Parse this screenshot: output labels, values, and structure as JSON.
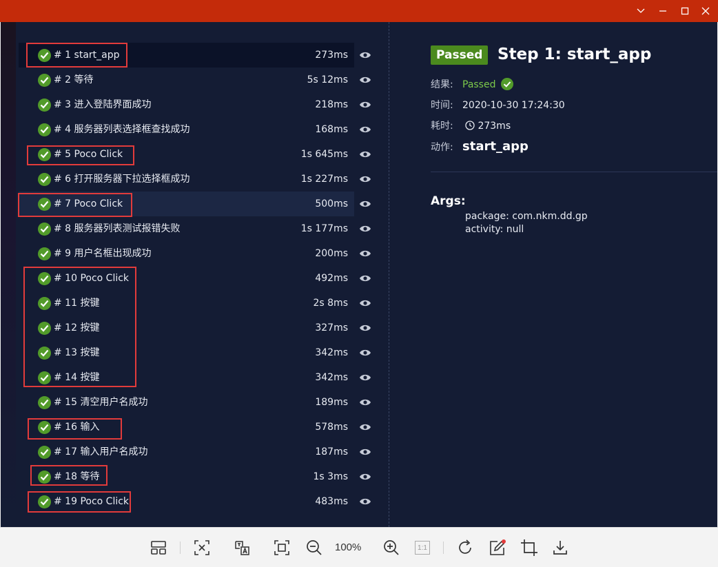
{
  "window": {
    "controls": [
      "minimize",
      "restore",
      "maximize",
      "close"
    ]
  },
  "colors": {
    "titlebar": "#c42b0a",
    "panel_bg": "#141c34",
    "passed_green": "#4b8a1e",
    "check_green": "#529b2a",
    "annotation_red": "#e23b3b"
  },
  "steps": [
    {
      "label": "# 1 start_app",
      "duration": "273ms",
      "status": "passed"
    },
    {
      "label": "# 2 等待",
      "duration": "5s 12ms",
      "status": "passed"
    },
    {
      "label": "# 3 进入登陆界面成功",
      "duration": "218ms",
      "status": "passed"
    },
    {
      "label": "# 4 服务器列表选择框查找成功",
      "duration": "168ms",
      "status": "passed"
    },
    {
      "label": "# 5 Poco Click",
      "duration": "1s 645ms",
      "status": "passed"
    },
    {
      "label": "# 6 打开服务器下拉选择框成功",
      "duration": "1s 227ms",
      "status": "passed"
    },
    {
      "label": "# 7 Poco Click",
      "duration": "500ms",
      "status": "passed"
    },
    {
      "label": "# 8 服务器列表测试报错失败",
      "duration": "1s 177ms",
      "status": "passed"
    },
    {
      "label": "# 9 用户名框出现成功",
      "duration": "200ms",
      "status": "passed"
    },
    {
      "label": "# 10 Poco Click",
      "duration": "492ms",
      "status": "passed"
    },
    {
      "label": "# 11 按键",
      "duration": "2s 8ms",
      "status": "passed"
    },
    {
      "label": "# 12 按键",
      "duration": "327ms",
      "status": "passed"
    },
    {
      "label": "# 13 按键",
      "duration": "342ms",
      "status": "passed"
    },
    {
      "label": "# 14 按键",
      "duration": "342ms",
      "status": "passed"
    },
    {
      "label": "# 15 清空用户名成功",
      "duration": "189ms",
      "status": "passed"
    },
    {
      "label": "# 16 输入",
      "duration": "578ms",
      "status": "passed"
    },
    {
      "label": "# 17 输入用户名成功",
      "duration": "187ms",
      "status": "passed"
    },
    {
      "label": "# 18 等待",
      "duration": "1s 3ms",
      "status": "passed"
    },
    {
      "label": "# 19 Poco Click",
      "duration": "483ms",
      "status": "passed"
    }
  ],
  "detail": {
    "badge": "Passed",
    "title": "Step 1: start_app",
    "result_key": "结果:",
    "result_value": "Passed",
    "time_key": "时间:",
    "time_value": "2020-10-30 17:24:30",
    "elapsed_key": "耗时:",
    "elapsed_value": "273ms",
    "action_key": "动作:",
    "action_value": "start_app",
    "args_title": "Args:",
    "args": [
      "package: com.nkm.dd.gp",
      "activity: null"
    ]
  },
  "toolbar": {
    "zoom": "100%",
    "one_to_one": "1:1"
  }
}
